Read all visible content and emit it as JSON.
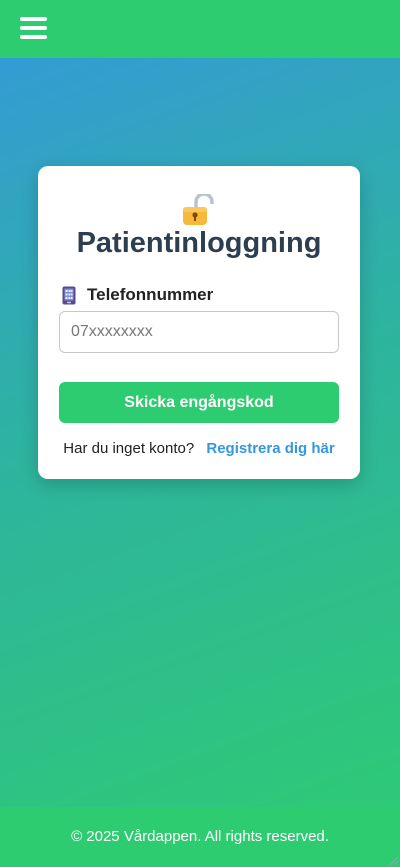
{
  "header": {
    "menu_icon": "hamburger-menu-icon",
    "bar_color": "#2ecc71"
  },
  "login": {
    "icon": "lock-icon",
    "title": "Patientinloggning",
    "phone_label_icon": "mobile-phone-icon",
    "phone_label": "Telefonnummer",
    "phone_value": "",
    "phone_placeholder": "07xxxxxxxx",
    "submit_label": "Skicka engångskod",
    "register_prompt": "Har du inget konto?",
    "register_link": "Registrera dig här"
  },
  "footer": {
    "text": "© 2025 Vårdappen. All rights reserved."
  },
  "colors": {
    "accent": "#2ecc71",
    "link": "#3498db",
    "title": "#2c3e50",
    "gradient_start": "#3498db",
    "gradient_end": "#2ecc71"
  }
}
